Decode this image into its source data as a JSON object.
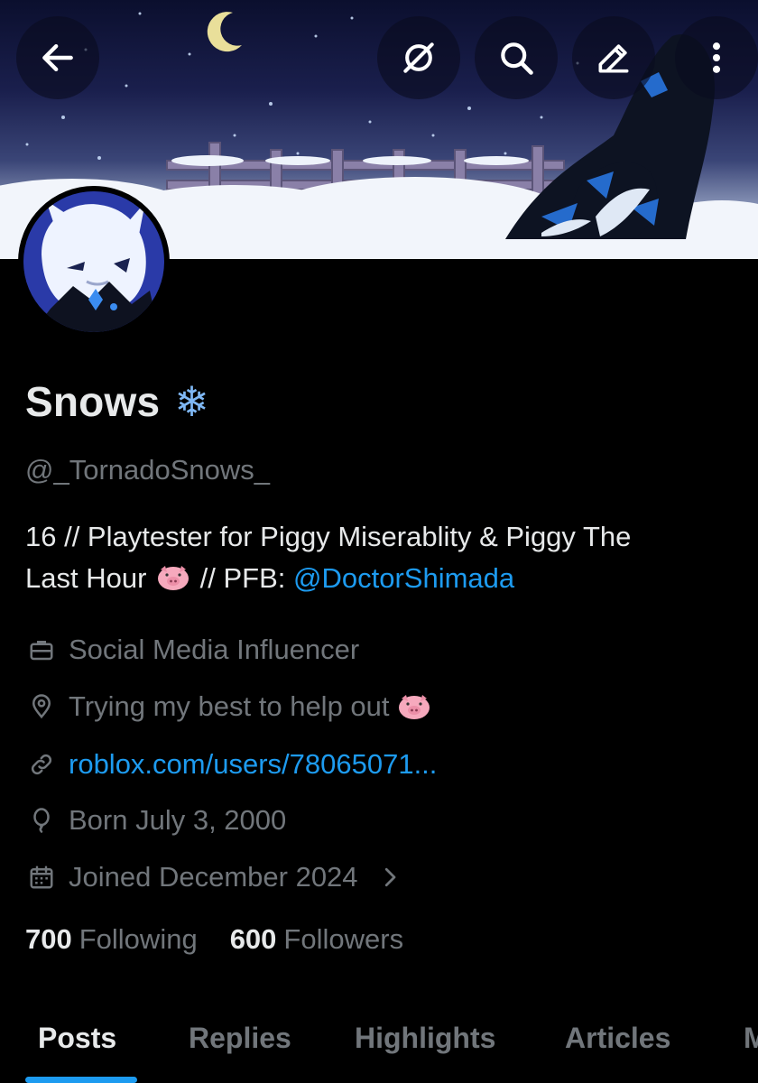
{
  "header": {
    "back_icon": "arrow-left-icon",
    "grok_icon": "grok-icon",
    "search_icon": "search-icon",
    "edit_icon": "pencil-icon",
    "more_icon": "more-vertical-icon"
  },
  "profile": {
    "display_name": "Snows",
    "name_emoji": "❄️",
    "handle": "@_TornadoSnows_",
    "bio_line1": "16 // Playtester for Piggy Miserablity & Piggy The",
    "bio_line2_prefix": "Last Hour",
    "bio_line2_middle": " // PFB: ",
    "bio_mention": "@DoctorShimada",
    "category": "Social Media Influencer",
    "location": "Trying my best to help out",
    "website": "roblox.com/users/78065071...",
    "birthday": "Born July 3, 2000",
    "joined": "Joined December 2024",
    "following_count": "700",
    "following_label": "Following",
    "followers_count": "600",
    "followers_label": "Followers"
  },
  "tabs": [
    {
      "label": "Posts",
      "active": true
    },
    {
      "label": "Replies",
      "active": false
    },
    {
      "label": "Highlights",
      "active": false
    },
    {
      "label": "Articles",
      "active": false
    },
    {
      "label": "M",
      "active": false
    }
  ],
  "colors": {
    "accent": "#1d9bf0",
    "text_primary": "#e7e9ea",
    "text_secondary": "#71767b",
    "background": "#000000"
  }
}
